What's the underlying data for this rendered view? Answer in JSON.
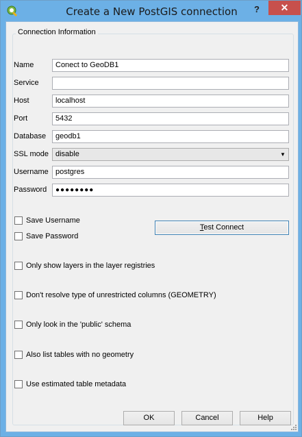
{
  "window": {
    "title": "Create a New PostGIS connection",
    "help_label": "?",
    "close_label": "✕"
  },
  "group": {
    "title": "Connection Information"
  },
  "fields": {
    "name": {
      "label": "Name",
      "value": "Conect to GeoDB1"
    },
    "service": {
      "label": "Service",
      "value": ""
    },
    "host": {
      "label": "Host",
      "value": "localhost"
    },
    "port": {
      "label": "Port",
      "value": "5432"
    },
    "database": {
      "label": "Database",
      "value": "geodb1"
    },
    "ssl_mode": {
      "label": "SSL mode",
      "value": "disable"
    },
    "username": {
      "label": "Username",
      "value": "postgres"
    },
    "password": {
      "label": "Password",
      "value": "●●●●●●●●"
    }
  },
  "checks": {
    "save_username": "Save Username",
    "save_password": "Save Password",
    "only_registries": "Only show layers in the layer registries",
    "dont_resolve": "Don't resolve type of unrestricted columns (GEOMETRY)",
    "public_schema": "Only look in the 'public' schema",
    "no_geometry": "Also list tables with no geometry",
    "estimated_metadata": "Use estimated table metadata"
  },
  "buttons": {
    "test_connect_first": "T",
    "test_connect_rest": "est Connect",
    "ok": "OK",
    "cancel": "Cancel",
    "help": "Help"
  }
}
